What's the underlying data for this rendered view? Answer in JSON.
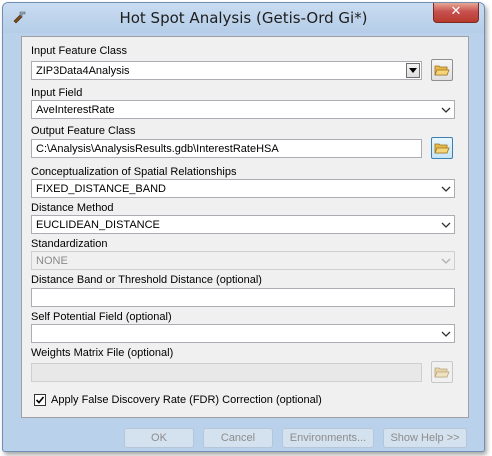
{
  "window": {
    "title": "Hot Spot Analysis (Getis-Ord Gi*)",
    "close_glyph": "✕"
  },
  "params": {
    "input_feature_class": {
      "label": "Input Feature Class",
      "value": "ZIP3Data4Analysis"
    },
    "input_field": {
      "label": "Input Field",
      "value": "AveInterestRate"
    },
    "output_feature_class": {
      "label": "Output Feature Class",
      "value": "C:\\Analysis\\AnalysisResults.gdb\\InterestRateHSA"
    },
    "conceptualization": {
      "label": "Conceptualization of Spatial Relationships",
      "value": "FIXED_DISTANCE_BAND"
    },
    "distance_method": {
      "label": "Distance Method",
      "value": "EUCLIDEAN_DISTANCE"
    },
    "standardization": {
      "label": "Standardization",
      "value": "NONE"
    },
    "distance_band": {
      "label": "Distance Band or Threshold Distance (optional)",
      "value": ""
    },
    "self_potential": {
      "label": "Self Potential Field (optional)",
      "value": ""
    },
    "weights_matrix": {
      "label": "Weights Matrix File (optional)",
      "value": ""
    },
    "fdr": {
      "label": "Apply False Discovery Rate (FDR) Correction (optional)",
      "checked": true
    }
  },
  "buttons": {
    "ok": "OK",
    "cancel": "Cancel",
    "environments": "Environments...",
    "show_help": "Show Help >>"
  }
}
